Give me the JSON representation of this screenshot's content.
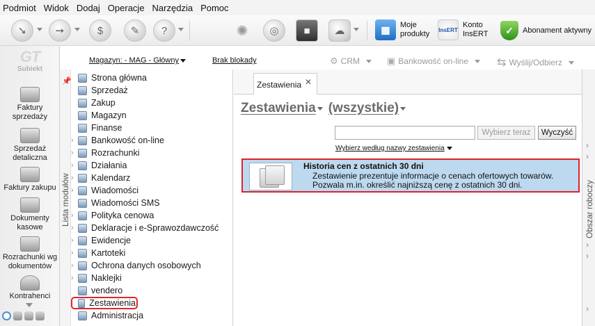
{
  "menu": [
    "Podmiot",
    "Widok",
    "Dodaj",
    "Operacje",
    "Narzędzia",
    "Pomoc"
  ],
  "toolbar": {
    "my_products": [
      "Moje",
      "produkty"
    ],
    "account": [
      "Konto",
      "InsERT"
    ],
    "account_badge": "InsERT",
    "subscription": "Abonament aktywny"
  },
  "addressbar": {
    "warehouse": "Magazyn: - MAG - Główny",
    "lock": "Brak blokady",
    "crm": "CRM",
    "banking": "Bankowość on-line",
    "send_receive": "Wyślij/Odbierz"
  },
  "rail": {
    "logo": "Subiekt",
    "items": [
      "Faktury\nsprzedaży",
      "Sprzedaż\ndetaliczna",
      "Faktury zakupu",
      "Dokumenty\nkasowe",
      "Rozrachunki wg\ndokumentów",
      "Kontrahenci"
    ]
  },
  "modules": {
    "sidebar_label": "Lista modułów",
    "items": [
      {
        "label": "Strona główna",
        "expand": false
      },
      {
        "label": "Sprzedaż",
        "expand": false
      },
      {
        "label": "Zakup",
        "expand": false
      },
      {
        "label": "Magazyn",
        "expand": false
      },
      {
        "label": "Finanse",
        "expand": false
      },
      {
        "label": "Bankowość on-line",
        "expand": true
      },
      {
        "label": "Rozrachunki",
        "expand": true
      },
      {
        "label": "Działania",
        "expand": true
      },
      {
        "label": "Kalendarz",
        "expand": true
      },
      {
        "label": "Wiadomości",
        "expand": true
      },
      {
        "label": "Wiadomości SMS",
        "expand": false
      },
      {
        "label": "Polityka cenowa",
        "expand": true
      },
      {
        "label": "Deklaracje i e-Sprawozdawczość",
        "expand": true
      },
      {
        "label": "Ewidencje",
        "expand": true
      },
      {
        "label": "Kartoteki",
        "expand": true
      },
      {
        "label": "Ochrona danych osobowych",
        "expand": true
      },
      {
        "label": "Naklejki",
        "expand": true
      },
      {
        "label": "vendero",
        "expand": false
      },
      {
        "label": "Zestawienia",
        "expand": false,
        "selected": true
      },
      {
        "label": "Administracja",
        "expand": false
      }
    ]
  },
  "main": {
    "tab": "Zestawienia",
    "title": "Zestawienia",
    "filter": "(wszystkie)",
    "search_value": "",
    "choose_now": "Wybierz teraz",
    "clear": "Wyczyść",
    "choose_by_name": "Wybierz według nazwy zestawienia",
    "report": {
      "title": "Historia cen z ostatnich 30 dni",
      "line1": "Zestawienie prezentuje informacje o cenach ofertowych towarów.",
      "line2": "Pozwala m.in. określić najniższą cenę z ostatnich 30 dni."
    }
  },
  "right_panel": {
    "label": "Obszar roboczy"
  },
  "colors": {
    "accent": "#d8232c",
    "selection": "#bdd9ef"
  }
}
